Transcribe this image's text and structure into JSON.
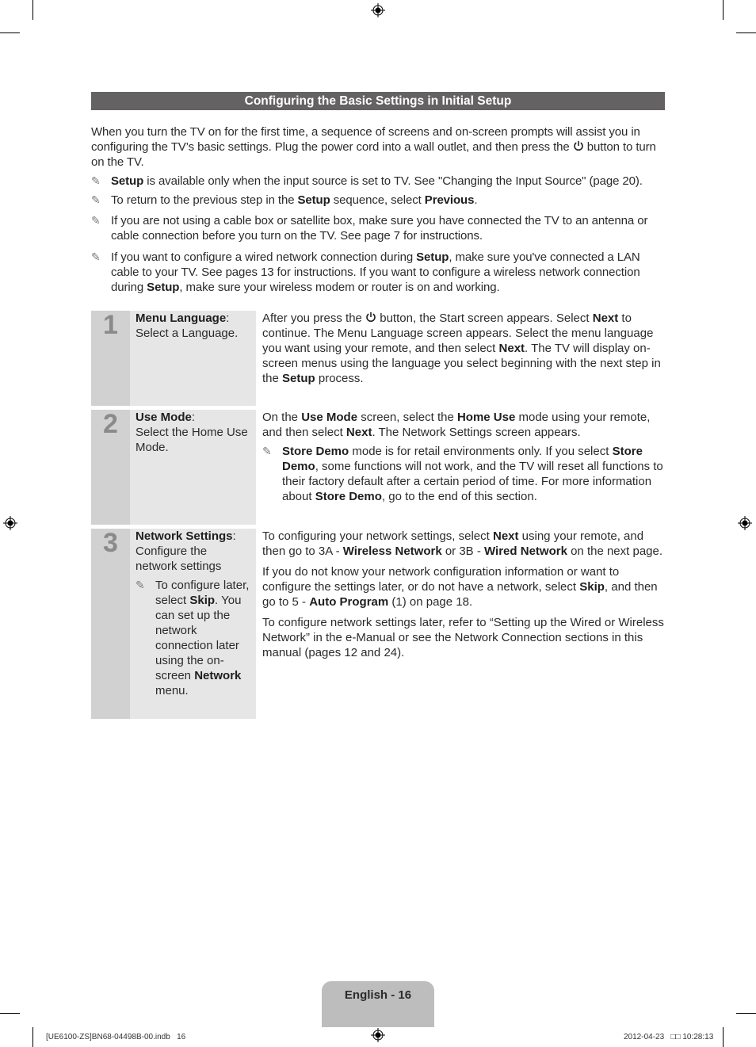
{
  "header": {
    "title": "Configuring the Basic Settings in Initial Setup"
  },
  "intro": {
    "text_before_icon": "When you turn the TV on for the first time, a sequence of screens and on-screen prompts will assist you in configuring the TV’s basic settings. Plug the power cord into a wall outlet, and then press the ",
    "power_icon": "power-icon",
    "text_after_icon": " button to turn on the TV."
  },
  "notes": [
    {
      "bold": "Setup",
      "text": " is available only when the input source is set to TV. See \"Changing the Input Source\" (page 20)."
    },
    {
      "pre": "To return to the previous step in the ",
      "bold1": "Setup",
      "mid": " sequence, select ",
      "bold2": "Previous",
      "post": "."
    },
    {
      "text": "If you are not using a cable box or satellite box, make sure you have connected the TV to an antenna or cable connection before you turn on the TV. See page 7 for instructions."
    },
    {
      "pre": "If you want to configure a wired network connection during ",
      "bold1": "Setup",
      "mid": ", make sure you've connected a LAN cable to your TV. See pages 13 for instructions. If you want to configure a wireless network connection during ",
      "bold2": "Setup",
      "post": ", make sure your wireless modem or router is on and working."
    }
  ],
  "note_icon": "pencil-note-icon",
  "steps": [
    {
      "number": "1",
      "label_bold": "Menu Language",
      "label_rest": ":",
      "label_sub": "Select a Language.",
      "desc": {
        "p1_pre": "After you press the ",
        "p1_mid": " button, the Start screen appears. Select ",
        "p1_b1": "Next",
        "p1_mid2": " to continue. The Menu Language screen appears. Select the menu language you want using your remote, and then select ",
        "p1_b2": "Next",
        "p1_mid3": ". The TV will display on-screen menus using the language you select beginning with the next step in the ",
        "p1_b3": "Setup",
        "p1_post": " process."
      }
    },
    {
      "number": "2",
      "label_bold": "Use Mode",
      "label_rest": ":",
      "label_sub": "Select the Home Use Mode.",
      "desc": {
        "pre": "On the ",
        "b1": "Use Mode",
        "m1": " screen, select the ",
        "b2": "Home Use",
        "m2": " mode using your remote, and then select ",
        "b3": "Next",
        "post": ". The Network Settings screen appears.",
        "note_b1": "Store Demo",
        "note_m1": " mode is for retail environments only. If you select ",
        "note_b2": "Store Demo",
        "note_m2": ", some functions will not work, and the TV will reset all functions to their factory default after a certain period of time. For more information about ",
        "note_b3": "Store Demo",
        "note_post": ", go to the end of this section."
      }
    },
    {
      "number": "3",
      "label_bold": "Network Settings",
      "label_rest": ":",
      "label_sub": "Configure the network settings",
      "label_note_pre": "To configure later, select ",
      "label_note_b1": "Skip",
      "label_note_mid": ". You can set up the network connection later using the on-screen ",
      "label_note_b2": "Network",
      "label_note_post": " menu.",
      "desc": {
        "p1_pre": "To configuring your network settings, select ",
        "p1_b1": "Next",
        "p1_m1": " using your remote, and then go to 3A - ",
        "p1_b2": "Wireless Network",
        "p1_m2": " or 3B - ",
        "p1_b3": "Wired Network",
        "p1_post": " on the next page.",
        "p2_pre": "If you do not know your network configuration information or want to configure the settings later, or do not have a network, select ",
        "p2_b1": "Skip",
        "p2_m1": ", and then go to 5 - ",
        "p2_b2": "Auto Program",
        "p2_post": " (1) on page 18.",
        "p3": "To configure network settings later, refer to “Setting up the Wired or Wireless Network” in the e-Manual or see the Network Connection sections in this manual (pages 12 and 24)."
      }
    }
  ],
  "footer": {
    "page_label": "English - 16",
    "file_info": "[UE6100-ZS]BN68-04498B-00.indb   16",
    "timestamp": "2012-04-23   □□ 10:28:13"
  }
}
